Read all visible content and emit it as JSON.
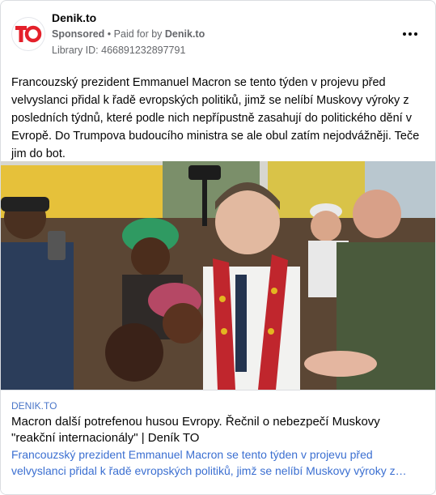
{
  "advertiser": {
    "name": "Denik.to",
    "sponsored_label": "Sponsored",
    "separator": "•",
    "paid_for_text": "Paid for by",
    "paid_for_name": "Denik.to",
    "library_id": "Library ID: 466891232897791",
    "logo_text": "TO",
    "logo_color": "#e4202a"
  },
  "post": {
    "body": "Francouzský prezident Emmanuel Macron se tento týden v projevu před velvyslanci přidal k řadě evropských politiků, jimž se nelíbí Muskovy výroky z posledních týdnů, které podle nich nepřípustně zasahují do politického dění v Evropě. Do Trumpova budoucího ministra se ale obul zatím nejodvážněji. Teče jim do bot."
  },
  "link_preview": {
    "domain": "DENIK.TO",
    "title": "Macron další potrefenou husou Evropy. Řečnil o nebezpečí Muskovy \"reakční internacionály\" | Deník TO",
    "description": "Francouzský prezident Emmanuel Macron se tento týden v projevu před velvyslanci přidal k řadě evropských politiků, jimž se nelíbí Muskovy výroky z posledních týdnů, které podle nich nepřípustně zasahují do politického dění v Evropě."
  },
  "icons": {
    "more": "more-options-icon",
    "logo": "denik-to-logo"
  },
  "colors": {
    "link_blue": "#3b6fd1",
    "domain_blue": "#4a76c8",
    "muted": "#65676b"
  }
}
